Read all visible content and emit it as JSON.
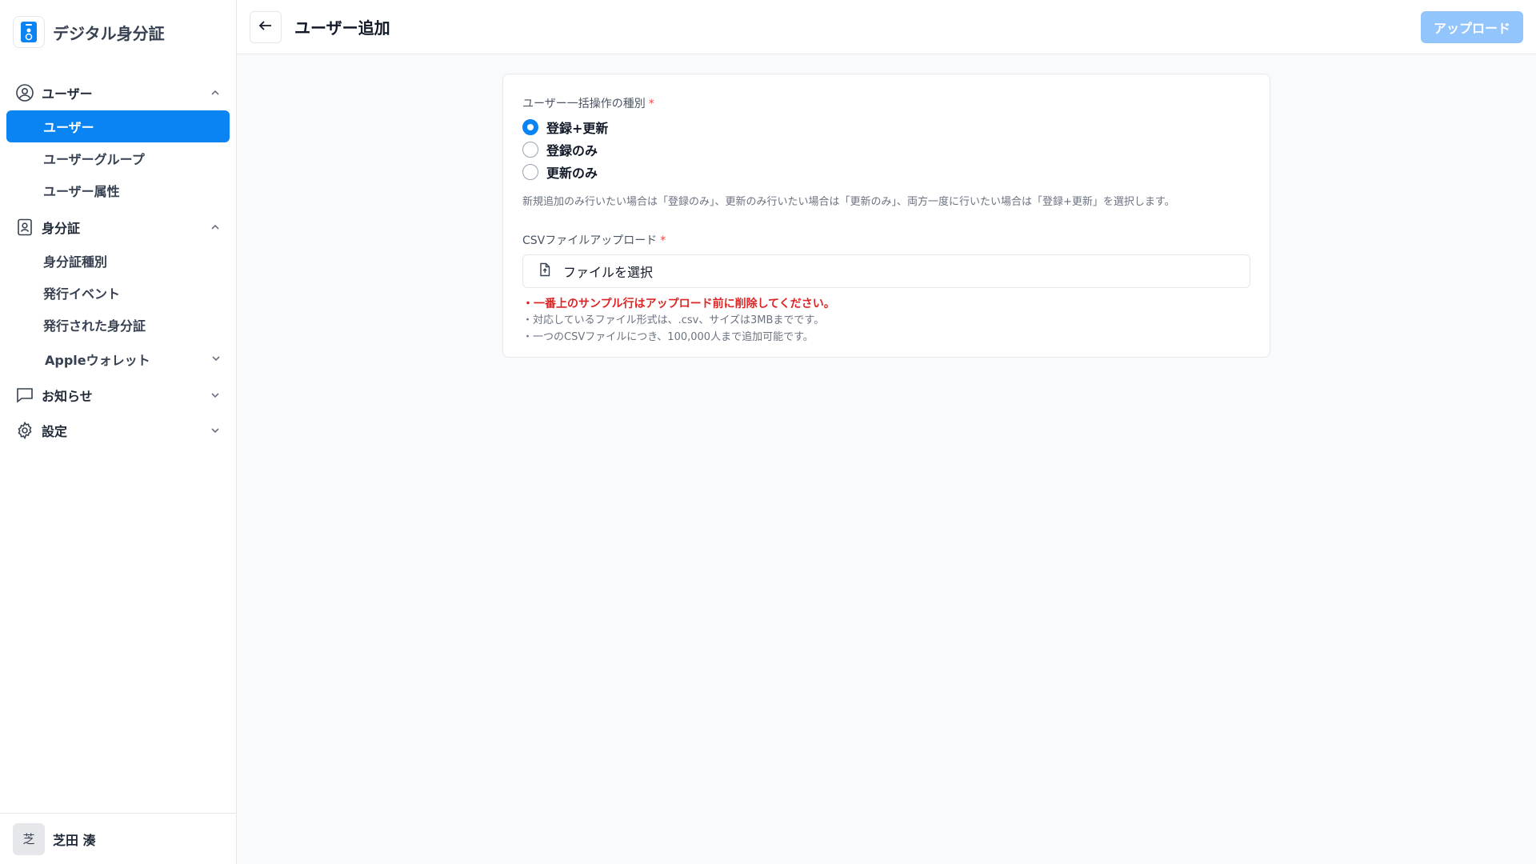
{
  "brand": {
    "title": "デジタル身分証"
  },
  "sidebar": {
    "sections": [
      {
        "label": "ユーザー",
        "items": [
          "ユーザー",
          "ユーザーグループ",
          "ユーザー属性"
        ]
      },
      {
        "label": "身分証",
        "items": [
          "身分証種別",
          "発行イベント",
          "発行された身分証"
        ],
        "sub_section": "Appleウォレット"
      },
      {
        "label": "お知らせ"
      },
      {
        "label": "設定"
      }
    ]
  },
  "user": {
    "initial": "芝",
    "name": "芝田 湊"
  },
  "header": {
    "title": "ユーザー追加",
    "upload_label": "アップロード"
  },
  "form": {
    "type_label": "ユーザー一括操作の種別",
    "required_mark": "*",
    "options": [
      "登録+更新",
      "登録のみ",
      "更新のみ"
    ],
    "selected_option": "登録+更新",
    "help_text": "新規追加のみ行いたい場合は「登録のみ」、更新のみ行いたい場合は「更新のみ」、両方一度に行いたい場合は「登録+更新」を選択します。",
    "csv_label": "CSVファイルアップロード",
    "file_placeholder": "ファイルを選択",
    "notes": [
      "・一番上のサンプル行はアップロード前に削除してください。",
      "・対応しているファイル形式は、.csv、サイズは3MBまでです。",
      "・一つのCSVファイルにつき、100,000人まで追加可能です。"
    ]
  },
  "colors": {
    "accent": "#0b84f3",
    "upload_disabled": "#93c5fd",
    "warning": "#dc2626"
  }
}
